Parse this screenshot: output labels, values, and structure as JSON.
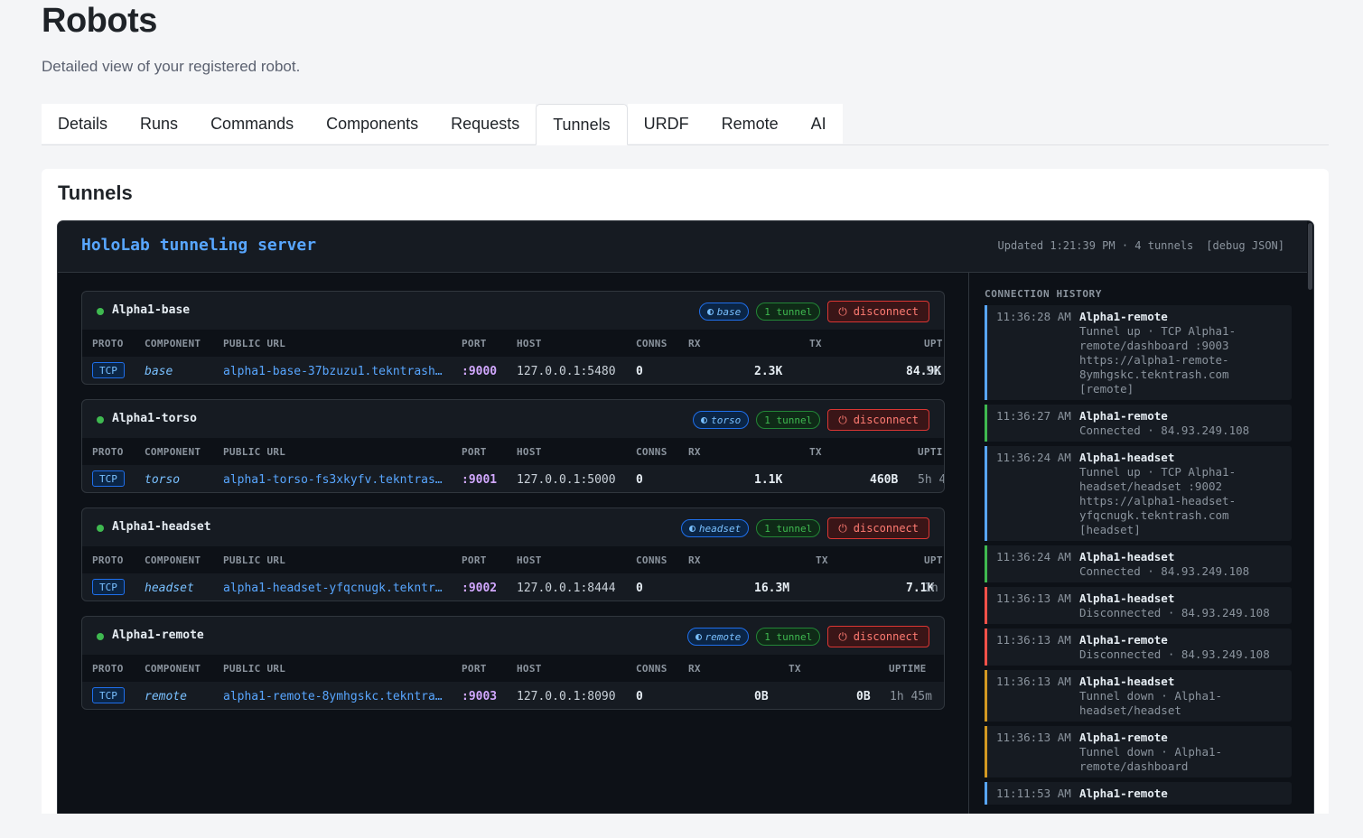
{
  "page": {
    "title": "Robots",
    "subtitle": "Detailed view of your registered robot."
  },
  "tabs": [
    "Details",
    "Runs",
    "Commands",
    "Components",
    "Requests",
    "Tunnels",
    "URDF",
    "Remote",
    "AI"
  ],
  "active_tab": "Tunnels",
  "card": {
    "title": "Tunnels"
  },
  "server": {
    "title": "HoloLab tunneling server",
    "updated": "Updated 1:21:39 PM · 4 tunnels",
    "debug_label": "[debug JSON]"
  },
  "table_headers": {
    "proto": "PROTO",
    "component": "COMPONENT",
    "public_url": "PUBLIC URL",
    "port": "PORT",
    "host": "HOST",
    "conns": "CONNS",
    "rx": "RX",
    "tx": "TX"
  },
  "robots": [
    {
      "name": "Alpha1-base",
      "component": "base",
      "tunnel_count": "1 tunnel",
      "disconnect": "disconnect",
      "uptime_header": "UPT",
      "proto": "TCP",
      "public_url": "alpha1-base-37bzuzu1.tekntrash…",
      "port": ":9000",
      "host": "127.0.0.1:5480",
      "conns": "0",
      "rx": "2.3K",
      "tx": "84.9K",
      "uptime": "5h"
    },
    {
      "name": "Alpha1-torso",
      "component": "torso",
      "tunnel_count": "1 tunnel",
      "disconnect": "disconnect",
      "uptime_header": "UPTI",
      "proto": "TCP",
      "public_url": "alpha1-torso-fs3xkyfv.tekntras…",
      "port": ":9001",
      "host": "127.0.0.1:5000",
      "conns": "0",
      "rx": "1.1K",
      "tx": "460B",
      "uptime": "5h 4"
    },
    {
      "name": "Alpha1-headset",
      "component": "headset",
      "tunnel_count": "1 tunnel",
      "disconnect": "disconnect",
      "uptime_header": "UPT",
      "proto": "TCP",
      "public_url": "alpha1-headset-yfqcnugk.tekntr…",
      "port": ":9002",
      "host": "127.0.0.1:8444",
      "conns": "0",
      "rx": "16.3M",
      "tx": "7.1K",
      "uptime": "1h"
    },
    {
      "name": "Alpha1-remote",
      "component": "remote",
      "tunnel_count": "1 tunnel",
      "disconnect": "disconnect",
      "uptime_header": "UPTIME",
      "proto": "TCP",
      "public_url": "alpha1-remote-8ymhgskc.tekntra…",
      "port": ":9003",
      "host": "127.0.0.1:8090",
      "conns": "0",
      "rx": "0B",
      "tx": "0B",
      "uptime": "1h 45m"
    }
  ],
  "history": {
    "title": "CONNECTION HISTORY",
    "events": [
      {
        "time": "11:36:28 AM",
        "robot": "Alpha1-remote",
        "kind": "blue",
        "detail": "Tunnel up · TCP Alpha1-\nremote/dashboard :9003\nhttps://alpha1-remote-\n8ymhgskc.tekntrash.com\n[remote]"
      },
      {
        "time": "11:36:27 AM",
        "robot": "Alpha1-remote",
        "kind": "green",
        "detail": "Connected · 84.93.249.108"
      },
      {
        "time": "11:36:24 AM",
        "robot": "Alpha1-headset",
        "kind": "blue",
        "detail": "Tunnel up · TCP Alpha1-\nheadset/headset :9002\nhttps://alpha1-headset-\nyfqcnugk.tekntrash.com\n[headset]"
      },
      {
        "time": "11:36:24 AM",
        "robot": "Alpha1-headset",
        "kind": "green",
        "detail": "Connected · 84.93.249.108"
      },
      {
        "time": "11:36:13 AM",
        "robot": "Alpha1-headset",
        "kind": "red",
        "detail": "Disconnected · 84.93.249.108"
      },
      {
        "time": "11:36:13 AM",
        "robot": "Alpha1-remote",
        "kind": "red",
        "detail": "Disconnected · 84.93.249.108"
      },
      {
        "time": "11:36:13 AM",
        "robot": "Alpha1-headset",
        "kind": "orange",
        "detail": "Tunnel down · Alpha1-\nheadset/headset"
      },
      {
        "time": "11:36:13 AM",
        "robot": "Alpha1-remote",
        "kind": "orange",
        "detail": "Tunnel down · Alpha1-\nremote/dashboard"
      },
      {
        "time": "11:11:53 AM",
        "robot": "Alpha1-remote",
        "kind": "blue",
        "detail": ""
      }
    ]
  },
  "colors": {
    "accent": "#58a6ff",
    "connected": "#3fb950",
    "disconnected": "#f85149",
    "tunnel_down": "#d29922",
    "port": "#d2a8ff"
  }
}
